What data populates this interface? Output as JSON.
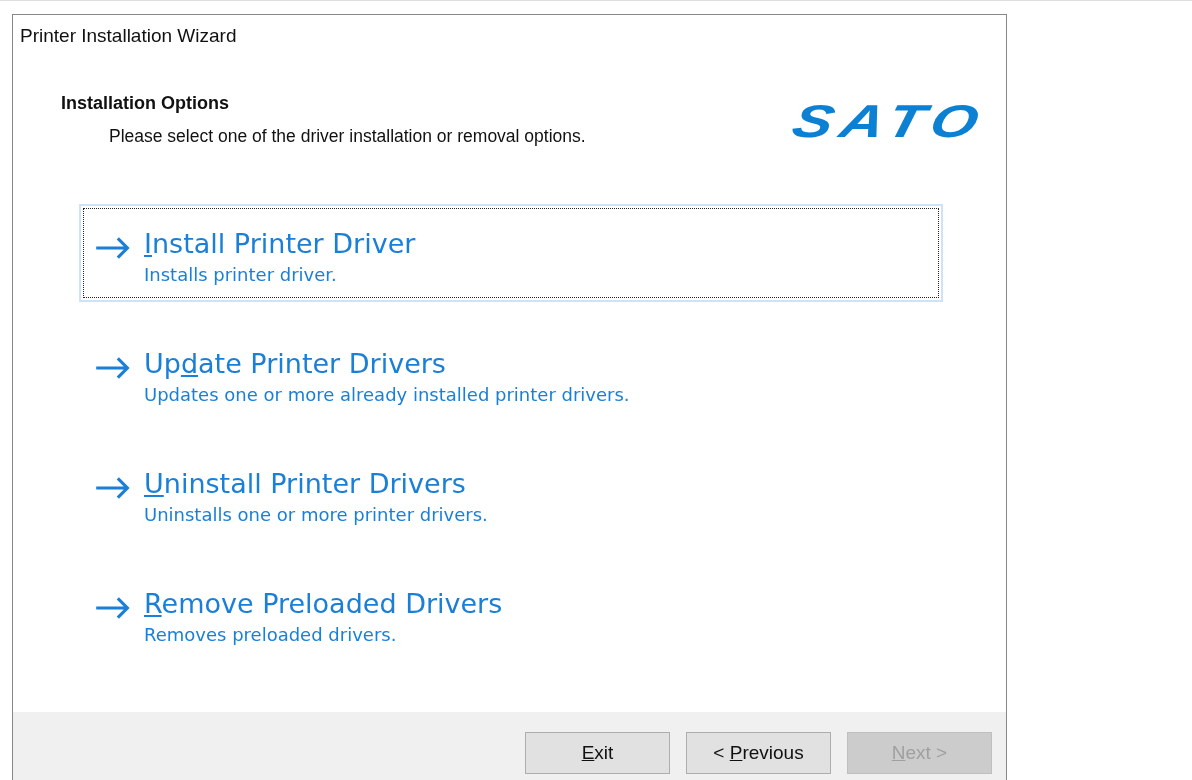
{
  "window": {
    "title": "Printer Installation Wizard"
  },
  "header": {
    "title": "Installation Options",
    "subtitle": "Please select one of the driver installation or removal options.",
    "logo": "SATO"
  },
  "options": [
    {
      "access_key": "I",
      "label_after": "nstall Printer Driver",
      "description": "Installs printer driver.",
      "selected": true
    },
    {
      "label_before": "Up",
      "access_key": "d",
      "label_after": "ate Printer Drivers",
      "description": "Updates one or more already installed printer drivers.",
      "selected": false
    },
    {
      "access_key": "U",
      "label_after": "ninstall Printer Drivers",
      "description": "Uninstalls one or more printer drivers.",
      "selected": false
    },
    {
      "access_key": "R",
      "label_after": "emove Preloaded Drivers",
      "description": "Removes preloaded drivers.",
      "selected": false
    }
  ],
  "buttons": [
    {
      "access_key": "E",
      "label_after": "xit",
      "disabled": false
    },
    {
      "label_before": "< ",
      "access_key": "P",
      "label_after": "revious",
      "disabled": false
    },
    {
      "access_key": "N",
      "label_after": "ext >",
      "disabled": true
    }
  ]
}
